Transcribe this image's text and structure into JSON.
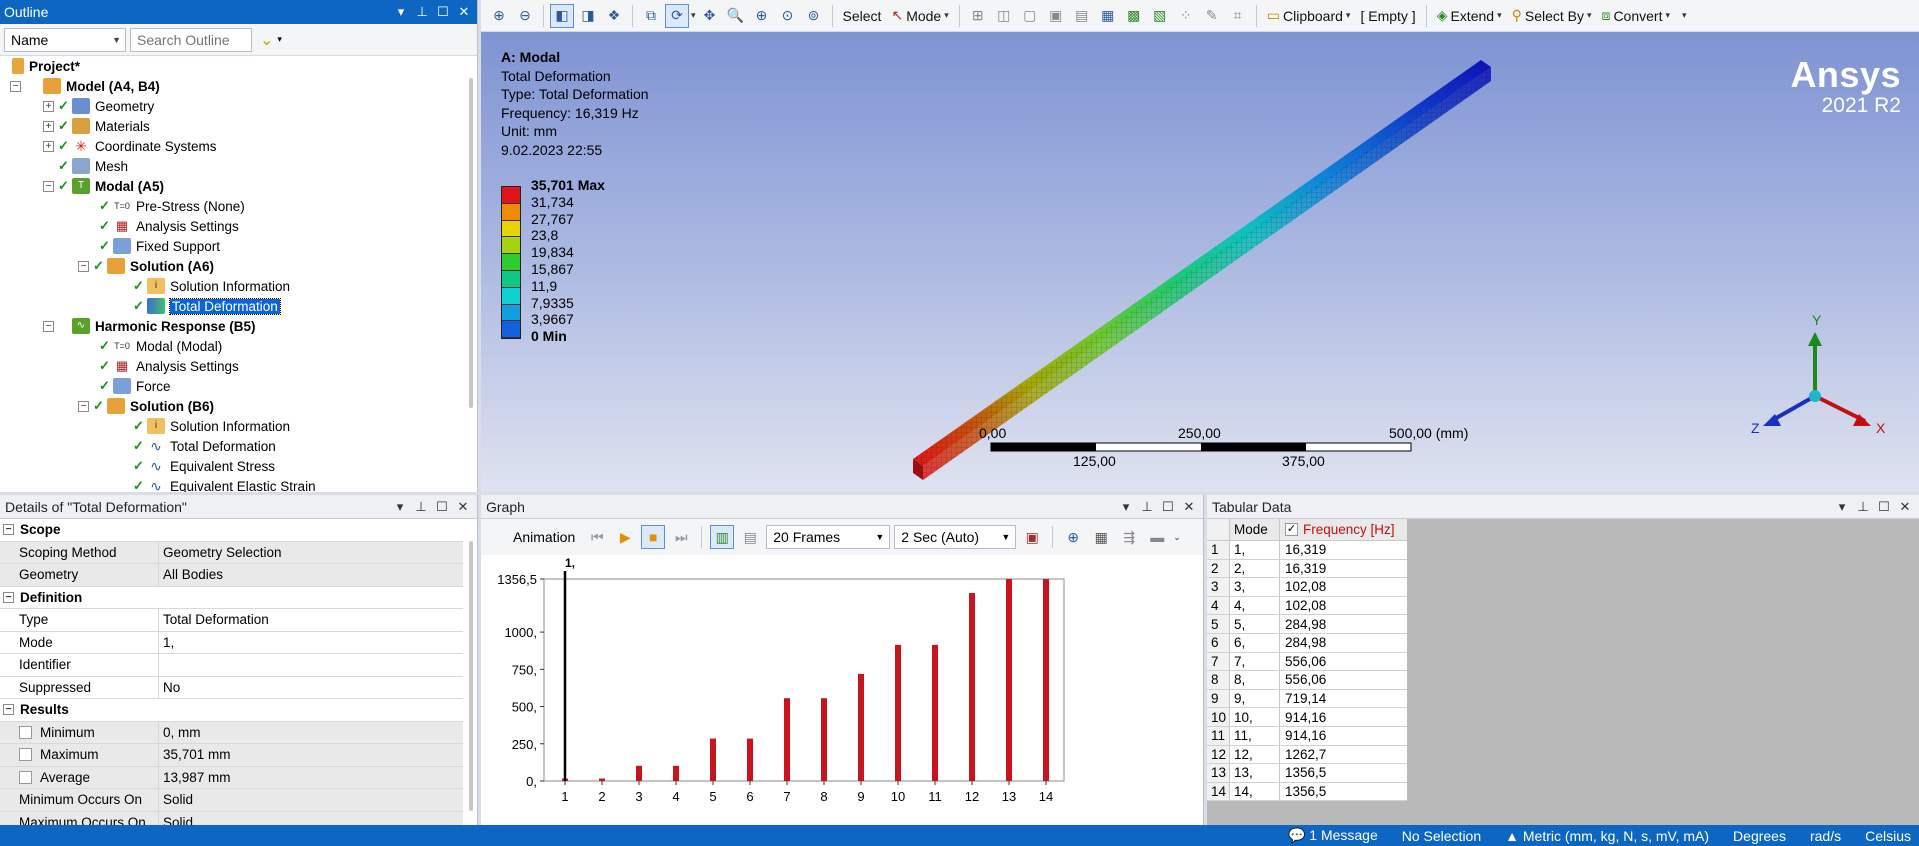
{
  "outline": {
    "title": "Outline",
    "filter_value": "Name",
    "search_placeholder": "Search Outline",
    "tree": [
      {
        "label": "Project*",
        "bold": true
      },
      {
        "label": "Model (A4, B4)",
        "bold": true
      },
      {
        "label": "Geometry"
      },
      {
        "label": "Materials"
      },
      {
        "label": "Coordinate Systems"
      },
      {
        "label": "Mesh"
      },
      {
        "label": "Modal (A5)",
        "bold": true
      },
      {
        "label": "Pre-Stress (None)"
      },
      {
        "label": "Analysis Settings"
      },
      {
        "label": "Fixed Support"
      },
      {
        "label": "Solution (A6)",
        "bold": true
      },
      {
        "label": "Solution Information"
      },
      {
        "label": "Total Deformation"
      },
      {
        "label": "Harmonic Response (B5)",
        "bold": true
      },
      {
        "label": "Modal (Modal)"
      },
      {
        "label": "Analysis Settings"
      },
      {
        "label": "Force"
      },
      {
        "label": "Solution (B6)",
        "bold": true
      },
      {
        "label": "Solution Information"
      },
      {
        "label": "Total Deformation"
      },
      {
        "label": "Equivalent Stress"
      },
      {
        "label": "Equivalent Elastic Strain"
      }
    ]
  },
  "details": {
    "title": "Details of \"Total Deformation\"",
    "groups": {
      "scope": "Scope",
      "definition": "Definition",
      "results": "Results"
    },
    "rows": {
      "scoping_method": {
        "k": "Scoping Method",
        "v": "Geometry Selection"
      },
      "geometry": {
        "k": "Geometry",
        "v": "All Bodies"
      },
      "type": {
        "k": "Type",
        "v": "Total Deformation"
      },
      "mode": {
        "k": "Mode",
        "v": "1,"
      },
      "identifier": {
        "k": "Identifier",
        "v": ""
      },
      "suppressed": {
        "k": "Suppressed",
        "v": "No"
      },
      "minimum": {
        "k": "Minimum",
        "v": "0, mm"
      },
      "maximum": {
        "k": "Maximum",
        "v": "35,701 mm"
      },
      "average": {
        "k": "Average",
        "v": "13,987 mm"
      },
      "min_occurs": {
        "k": "Minimum Occurs On",
        "v": "Solid"
      },
      "max_occurs": {
        "k": "Maximum Occurs On",
        "v": "Solid"
      }
    }
  },
  "toolbar": {
    "select": "Select",
    "mode": "Mode",
    "clipboard": "Clipboard",
    "empty": "[ Empty ]",
    "extend": "Extend",
    "select_by": "Select By",
    "convert": "Convert"
  },
  "viewport": {
    "info": [
      "A: Modal",
      "Total Deformation",
      "Type: Total Deformation",
      "Frequency: 16,319 Hz",
      "Unit: mm",
      "9.02.2023 22:55"
    ],
    "legend_labels": [
      "35,701 Max",
      "31,734",
      "27,767",
      "23,8",
      "19,834",
      "15,867",
      "11,9",
      "7,9335",
      "3,9667",
      "0 Min"
    ],
    "legend_colors": [
      "#e0141a",
      "#f08a00",
      "#e8d400",
      "#a6d40a",
      "#2ecc2e",
      "#10c884",
      "#10d0d0",
      "#10a0e0",
      "#1060e0",
      "#1010c8"
    ],
    "brand": "Ansys",
    "version": "2021 R2",
    "scale_top": [
      "0,00",
      "250,00",
      "500,00 (mm)"
    ],
    "scale_bottom": [
      "125,00",
      "375,00"
    ],
    "axes": {
      "x": "X",
      "y": "Y",
      "z": "Z"
    }
  },
  "graph": {
    "title": "Graph",
    "animation_label": "Animation",
    "frames": "20 Frames",
    "duration": "2 Sec (Auto)"
  },
  "chart_data": {
    "type": "bar",
    "categories": [
      "1",
      "2",
      "3",
      "4",
      "5",
      "6",
      "7",
      "8",
      "9",
      "10",
      "11",
      "12",
      "13",
      "14"
    ],
    "values": [
      16.319,
      16.319,
      102.08,
      102.08,
      284.98,
      284.98,
      556.06,
      556.06,
      719.14,
      914.16,
      914.16,
      1262.7,
      1356.5,
      1356.5
    ],
    "yticks": [
      "0,",
      "250,",
      "500,",
      "750,",
      "1000,",
      "1356,5"
    ],
    "ylim": [
      0,
      1356.5
    ],
    "marker_label": "1,",
    "bar_color": "#c8141c",
    "grid": false
  },
  "tabular": {
    "title": "Tabular Data",
    "col_mode": "Mode",
    "col_freq": "Frequency [Hz]",
    "rows": [
      [
        "1",
        "1,",
        "16,319"
      ],
      [
        "2",
        "2,",
        "16,319"
      ],
      [
        "3",
        "3,",
        "102,08"
      ],
      [
        "4",
        "4,",
        "102,08"
      ],
      [
        "5",
        "5,",
        "284,98"
      ],
      [
        "6",
        "6,",
        "284,98"
      ],
      [
        "7",
        "7,",
        "556,06"
      ],
      [
        "8",
        "8,",
        "556,06"
      ],
      [
        "9",
        "9,",
        "719,14"
      ],
      [
        "10",
        "10,",
        "914,16"
      ],
      [
        "11",
        "11,",
        "914,16"
      ],
      [
        "12",
        "12,",
        "1262,7"
      ],
      [
        "13",
        "13,",
        "1356,5"
      ],
      [
        "14",
        "14,",
        "1356,5"
      ]
    ]
  },
  "status": {
    "messages": "1 Message",
    "selection": "No Selection",
    "units": "Metric (mm, kg, N, s, mV, mA)",
    "angle": "Degrees",
    "rate": "rad/s",
    "temp": "Celsius"
  }
}
